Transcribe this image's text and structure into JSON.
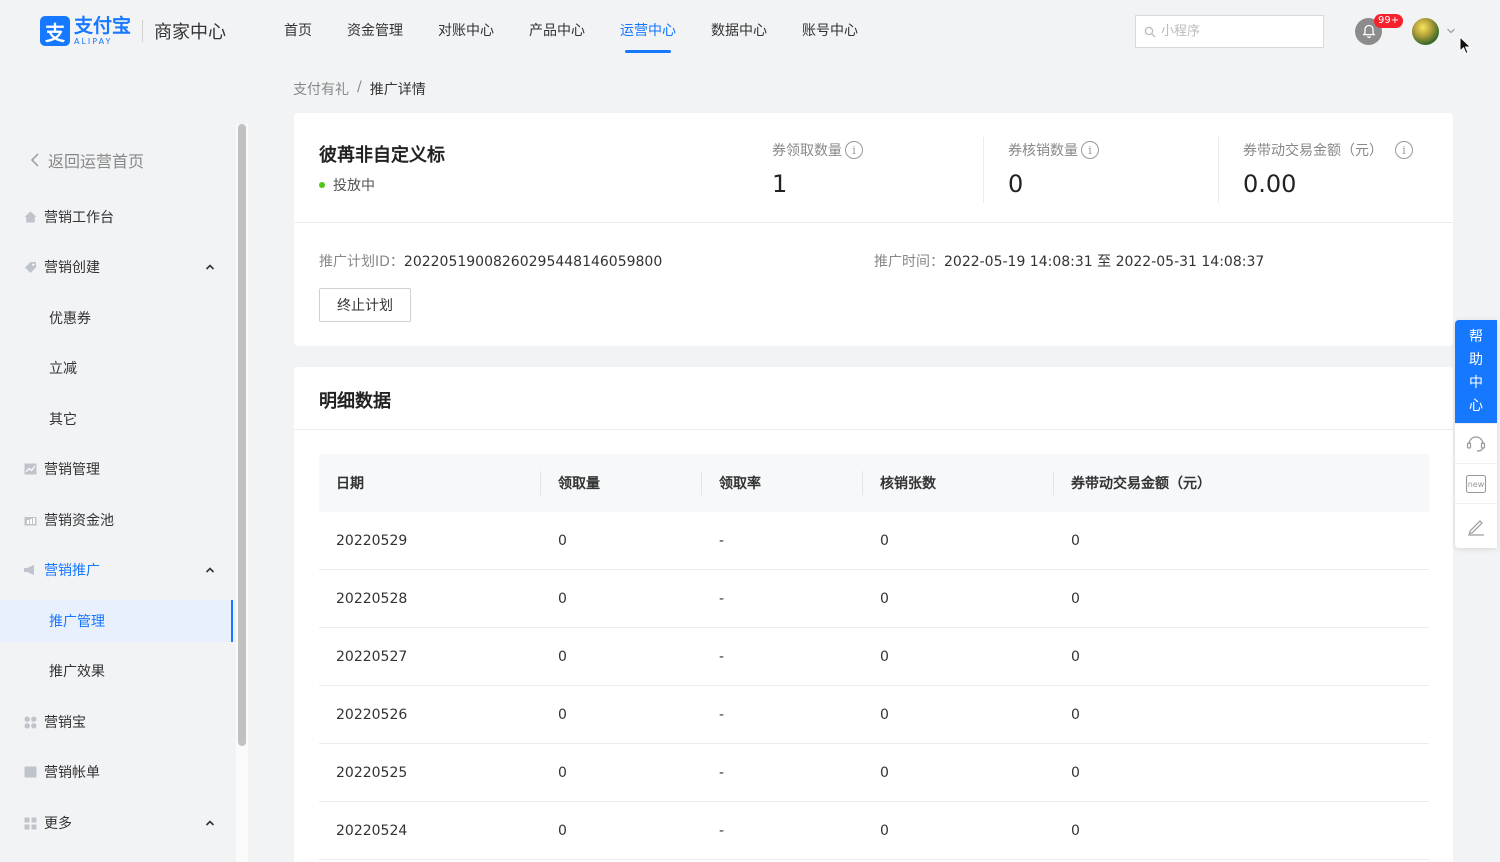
{
  "header": {
    "logo_mark": "支",
    "logo_cn": "支付宝",
    "logo_en": "ALIPAY",
    "logo_sub": "商家中心",
    "nav": [
      "首页",
      "资金管理",
      "对账中心",
      "产品中心",
      "运营中心",
      "数据中心",
      "账号中心"
    ],
    "active_nav": "运营中心",
    "search_placeholder": "小程序",
    "notification_badge": "99+",
    "accent_color": "#1677ff"
  },
  "breadcrumb": {
    "parent": "支付有礼",
    "separator": "/",
    "current": "推广详情"
  },
  "sidebar": {
    "back_label": "返回运营首页",
    "items": [
      {
        "label": "营销工作台",
        "icon": "home-icon"
      },
      {
        "label": "营销创建",
        "icon": "tag-icon"
      },
      {
        "label": "优惠券"
      },
      {
        "label": "立减"
      },
      {
        "label": "其它"
      },
      {
        "label": "营销管理",
        "icon": "chart-icon"
      },
      {
        "label": "营销资金池",
        "icon": "fund-icon"
      },
      {
        "label": "营销推广",
        "icon": "megaphone-icon"
      },
      {
        "label": "推广管理"
      },
      {
        "label": "推广效果"
      },
      {
        "label": "营销宝",
        "icon": "apps-icon"
      },
      {
        "label": "营销帐单",
        "icon": "bill-icon"
      },
      {
        "label": "更多",
        "icon": "grid-icon"
      }
    ],
    "selected": "推广管理"
  },
  "summary": {
    "plan_name": "彼苒非自定义标",
    "status": "投放中",
    "status_color": "#52c41a",
    "metrics": [
      {
        "label": "券领取数量",
        "value": "1"
      },
      {
        "label": "券核销数量",
        "value": "0"
      },
      {
        "label": "券带动交易金额（元）",
        "value": "0.00"
      }
    ],
    "plan_id_label": "推广计划ID：",
    "plan_id": "20220519008260295448146059800",
    "time_label": "推广时间：",
    "time_value": "2022-05-19 14:08:31 至 2022-05-31 14:08:37",
    "stop_button": "终止计划"
  },
  "detail": {
    "title": "明细数据",
    "columns": [
      "日期",
      "领取量",
      "领取率",
      "核销张数",
      "券带动交易金额（元）"
    ],
    "rows": [
      [
        "20220529",
        "0",
        "-",
        "0",
        "0"
      ],
      [
        "20220528",
        "0",
        "-",
        "0",
        "0"
      ],
      [
        "20220527",
        "0",
        "-",
        "0",
        "0"
      ],
      [
        "20220526",
        "0",
        "-",
        "0",
        "0"
      ],
      [
        "20220525",
        "0",
        "-",
        "0",
        "0"
      ],
      [
        "20220524",
        "0",
        "-",
        "0",
        "0"
      ]
    ]
  },
  "help_widget": {
    "help_chars": [
      "帮",
      "助",
      "中",
      "心"
    ],
    "icons": [
      "customer-service-icon",
      "new-icon",
      "edit-icon"
    ]
  }
}
